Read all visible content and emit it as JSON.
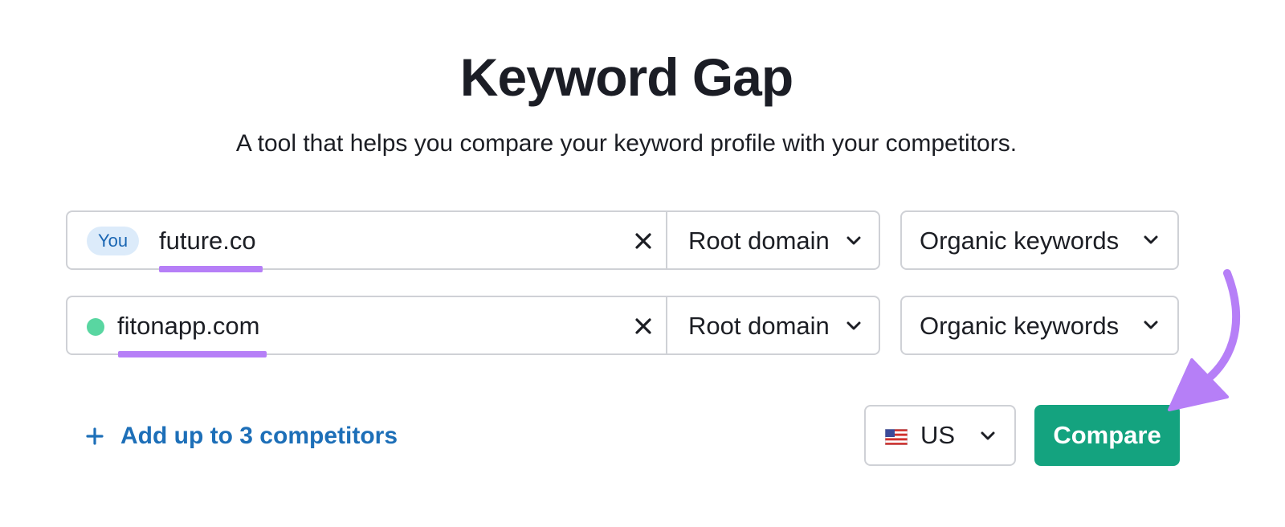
{
  "header": {
    "title": "Keyword Gap",
    "subtitle": "A tool that helps you compare your keyword profile with your competitors."
  },
  "rows": [
    {
      "badge": "You",
      "domain": "future.co",
      "scope": "Root domain",
      "keyword_type": "Organic keywords",
      "marker": "you-badge"
    },
    {
      "domain": "fitonapp.com",
      "scope": "Root domain",
      "keyword_type": "Organic keywords",
      "marker": "green-dot",
      "marker_color": "#59d6a1"
    }
  ],
  "add_competitors": {
    "icon": "plus-icon",
    "label": "Add up to 3 competitors"
  },
  "country": {
    "flag": "us-flag-icon",
    "value": "US"
  },
  "compare_button": {
    "label": "Compare"
  },
  "colors": {
    "accent_green": "#14a37f",
    "link_blue": "#1d6fb8",
    "annotation_purple": "#b67ff7",
    "badge_bg": "#dcebfa"
  }
}
